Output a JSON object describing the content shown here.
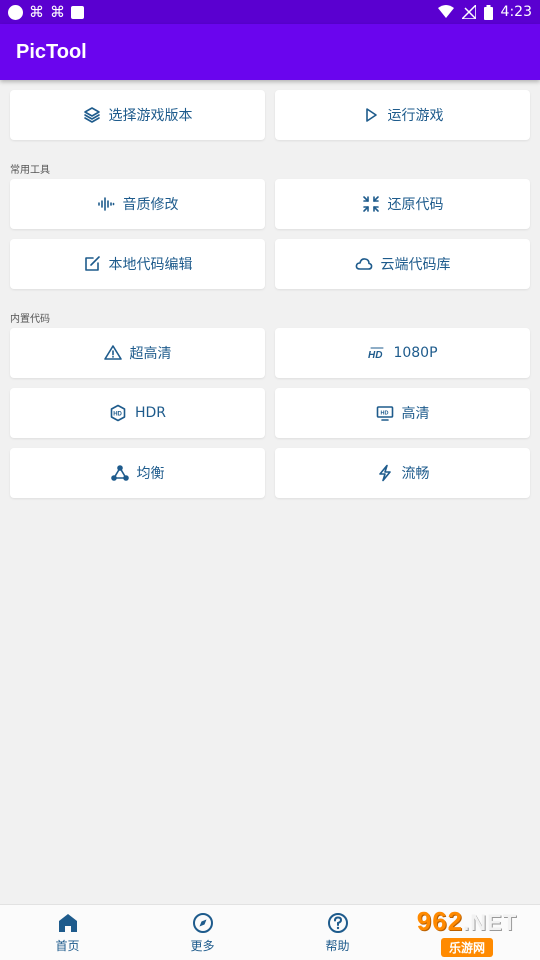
{
  "status_bar": {
    "time": "4:23",
    "left_icons": [
      "circle-icon",
      "app-notification-icon",
      "app-notification-icon",
      "square-icon"
    ],
    "right_icons": [
      "wifi-icon",
      "no-signal-icon",
      "battery-icon"
    ]
  },
  "app_bar": {
    "title": "PicTool"
  },
  "top_buttons": [
    {
      "label": "选择游戏版本",
      "icon": "layers-icon"
    },
    {
      "label": "运行游戏",
      "icon": "play-icon"
    }
  ],
  "sections": {
    "common_tools": {
      "title": "常用工具",
      "buttons": [
        {
          "label": "音质修改",
          "icon": "audio-wave-icon"
        },
        {
          "label": "还原代码",
          "icon": "restore-icon"
        },
        {
          "label": "本地代码编辑",
          "icon": "edit-icon"
        },
        {
          "label": "云端代码库",
          "icon": "cloud-icon"
        }
      ]
    },
    "builtin_codes": {
      "title": "内置代码",
      "buttons": [
        {
          "label": "超高清",
          "icon": "warning-icon"
        },
        {
          "label": "1080P",
          "icon": "hd-icon"
        },
        {
          "label": "HDR",
          "icon": "hdr-icon"
        },
        {
          "label": "高清",
          "icon": "hd-monitor-icon"
        },
        {
          "label": "均衡",
          "icon": "balance-icon"
        },
        {
          "label": "流畅",
          "icon": "lightning-icon"
        }
      ]
    }
  },
  "bottom_nav": [
    {
      "label": "首页",
      "icon": "home-icon",
      "selected": true
    },
    {
      "label": "更多",
      "icon": "compass-icon",
      "selected": false
    },
    {
      "label": "帮助",
      "icon": "help-icon",
      "selected": false
    }
  ],
  "watermark": {
    "top": "962",
    "suffix": ".NET",
    "bottom": "乐游网"
  },
  "colors": {
    "status_bar": "#5a00d0",
    "app_bar": "#6a05ee",
    "accent_text": "#1e5b8c",
    "background": "#f1f1f1",
    "watermark": "#ff8a00"
  }
}
